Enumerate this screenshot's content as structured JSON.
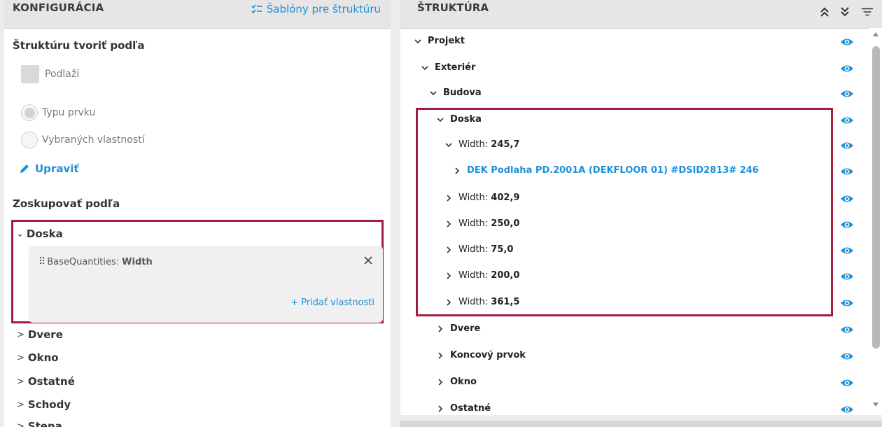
{
  "left": {
    "title": "KONFIGURÁCIA",
    "templates_link": "Šablóny pre štruktúru",
    "structure_by_title": "Štruktúru tvoriť podľa",
    "floors_checkbox": "Podlaží",
    "radio_element_type": "Typu prvku",
    "radio_selected_properties": "Vybraných vlastností",
    "edit_link": "Upraviť",
    "group_by_title": "Zoskupovať podľa",
    "expanded_group": {
      "name": "Doska",
      "property_prefix": "BaseQuantities:",
      "property_name": "Width",
      "add_property": "+ Pridať vlastnosti"
    },
    "groups": [
      "Dvere",
      "Okno",
      "Ostatné",
      "Schody",
      "Stena"
    ]
  },
  "right": {
    "title": "ŠTRUKTÚRA",
    "tree": [
      {
        "label": "Projekt",
        "value": ""
      },
      {
        "label": "Exteriér",
        "value": ""
      },
      {
        "label": "Budova",
        "value": ""
      },
      {
        "label": "Doska",
        "value": ""
      },
      {
        "label": "Width:",
        "value": "245,7"
      },
      {
        "label": "DEK Podlaha PD.2001A (DEKFLOOR 01) #DSID2813# 246",
        "value": ""
      },
      {
        "label": "Width:",
        "value": "402,9"
      },
      {
        "label": "Width:",
        "value": "250,0"
      },
      {
        "label": "Width:",
        "value": "75,0"
      },
      {
        "label": "Width:",
        "value": "200,0"
      },
      {
        "label": "Width:",
        "value": "361,5"
      },
      {
        "label": "Dvere",
        "value": ""
      },
      {
        "label": "Koncový prvok",
        "value": ""
      },
      {
        "label": "Okno",
        "value": ""
      },
      {
        "label": "Ostatné",
        "value": ""
      }
    ]
  },
  "colors": {
    "accent": "#1e8fd6",
    "highlight": "#a31e3c",
    "header_bg": "#e6e6e6"
  }
}
